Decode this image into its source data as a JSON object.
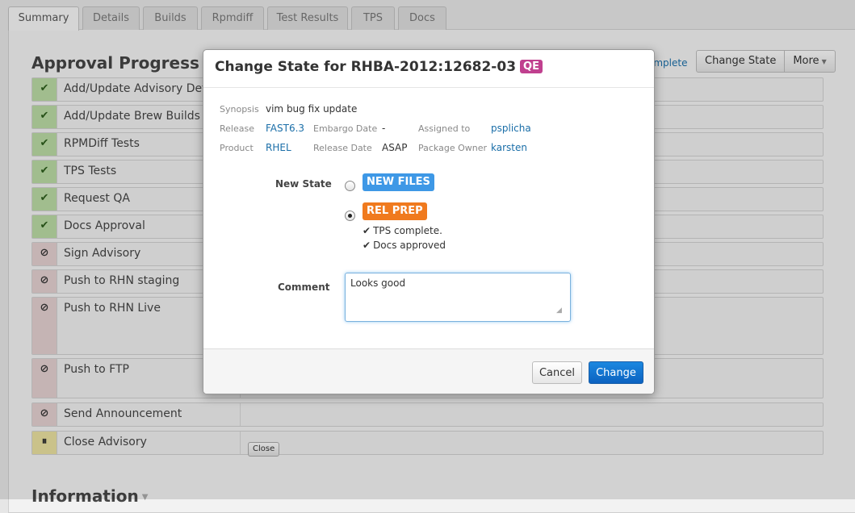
{
  "tabs": [
    "Summary",
    "Details",
    "Builds",
    "Rpmdiff",
    "Test Results",
    "TPS",
    "Docs"
  ],
  "page": {
    "section_title": "Approval Progress",
    "info_title": "Information",
    "link_text": "omplete",
    "buttons": {
      "change_state": "Change State",
      "more": "More"
    }
  },
  "steps": [
    {
      "status": "done",
      "icon": "✔",
      "label": "Add/Update Advisory Details"
    },
    {
      "status": "done",
      "icon": "✔",
      "label": "Add/Update Brew Builds"
    },
    {
      "status": "done",
      "icon": "✔",
      "label": "RPMDiff Tests"
    },
    {
      "status": "done",
      "icon": "✔",
      "label": "TPS Tests"
    },
    {
      "status": "done",
      "icon": "✔",
      "label": "Request QA"
    },
    {
      "status": "done",
      "icon": "✔",
      "label": "Docs Approval"
    },
    {
      "status": "blocked",
      "icon": "⊘",
      "label": "Sign Advisory"
    },
    {
      "status": "blocked",
      "icon": "⊘",
      "label": "Push to RHN staging"
    },
    {
      "status": "blocked",
      "icon": "⊘",
      "label": "Push to RHN Live"
    },
    {
      "status": "blocked",
      "icon": "⊘",
      "label": "Push to FTP"
    },
    {
      "status": "blocked",
      "icon": "⊘",
      "label": "Send Announcement"
    },
    {
      "status": "paused",
      "icon": "⏸",
      "label": "Close Advisory",
      "button": "Close"
    }
  ],
  "modal": {
    "title": "Change State for RHBA-2012:12682-03",
    "badge": "QE",
    "synopsis_label": "Synopsis",
    "synopsis": "vim bug fix update",
    "release_label": "Release",
    "release": "FAST6.3",
    "embargo_label": "Embargo Date",
    "embargo": "-",
    "assigned_label": "Assigned to",
    "assigned": "psplicha",
    "product_label": "Product",
    "product": "RHEL",
    "release_date_label": "Release Date",
    "release_date": "ASAP",
    "owner_label": "Package Owner",
    "owner": "karsten",
    "new_state_label": "New State",
    "states": [
      {
        "label": "NEW FILES",
        "selected": false
      },
      {
        "label": "REL PREP",
        "selected": true
      }
    ],
    "conditions": [
      "TPS complete.",
      "Docs approved"
    ],
    "comment_label": "Comment",
    "comment": "Looks good",
    "cancel": "Cancel",
    "change": "Change"
  },
  "colors": {
    "done": "#b9d9a4",
    "blocked": "#e3cfcf",
    "paused": "#e9df9f",
    "qe_badge": "#c0408f",
    "new_files": "#3e98e6",
    "rel_prep": "#f07a1e",
    "primary": "#0c62c0"
  }
}
